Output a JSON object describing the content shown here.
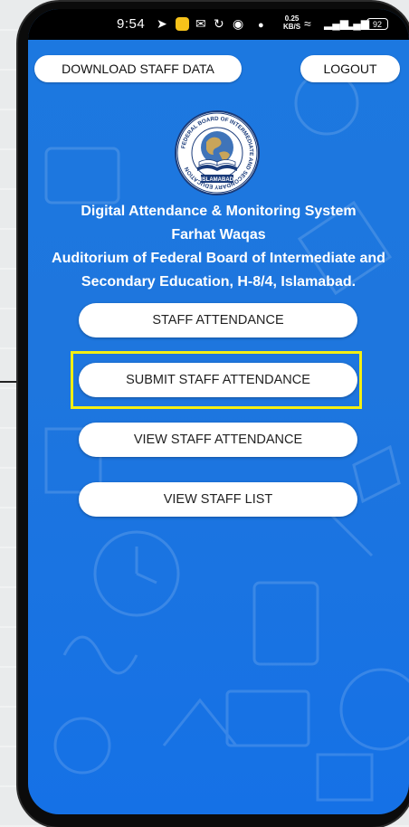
{
  "status_bar": {
    "time": "9:54",
    "network_speed_value": "0.25",
    "network_speed_unit": "KB/S",
    "battery": "92"
  },
  "header": {
    "download_label": "DOWNLOAD STAFF DATA",
    "logout_label": "LOGOUT"
  },
  "info": {
    "system_title": "Digital Attendance & Monitoring System",
    "user_name": "Farhat Waqas",
    "venue_line1": "Auditorium of Federal Board of Intermediate and",
    "venue_line2": "Secondary Education, H-8/4, Islamabad."
  },
  "logo": {
    "ring_text": "FEDERAL BOARD OF INTERMEDIATE AND SECONDARY EDUCATION",
    "city_text": "ISLAMABAD"
  },
  "menu": {
    "staff_attendance": "STAFF ATTENDANCE",
    "submit_staff_attendance": "SUBMIT STAFF ATTENDANCE",
    "view_staff_attendance": "VIEW STAFF ATTENDANCE",
    "view_staff_list": "VIEW STAFF LIST"
  },
  "colors": {
    "screen_blue": "#1c78e0",
    "highlight_yellow": "#f3ef12"
  }
}
